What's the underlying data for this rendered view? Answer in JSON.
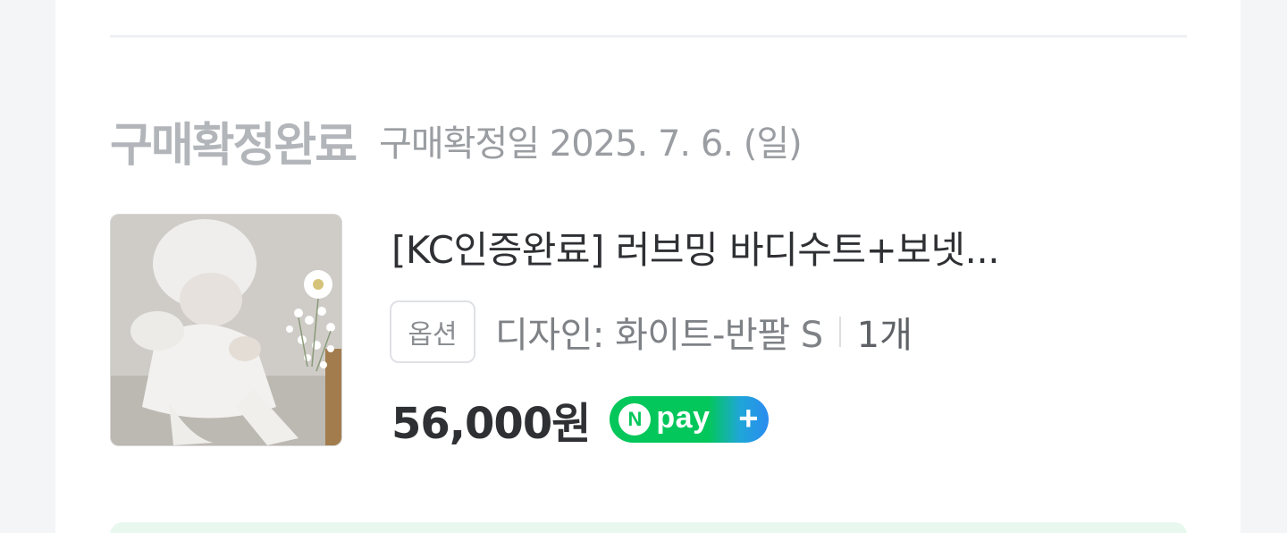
{
  "order": {
    "status_title": "구매확정완료",
    "status_date": "구매확정일 2025. 7. 6. (일)",
    "product": {
      "name": "[KC인증완료] 러브밍 바디수트+보넷...",
      "thumbnail_icon": "product-photo-baby-dress",
      "option_badge": "옵션",
      "option_text": "디자인: 화이트-반팔 S",
      "quantity": "1개",
      "price": "56,000원"
    },
    "npay": {
      "n": "N",
      "pay": "pay",
      "plus": "+",
      "colors": {
        "green": "#03c75a",
        "blue": "#2b8bf0"
      }
    }
  }
}
